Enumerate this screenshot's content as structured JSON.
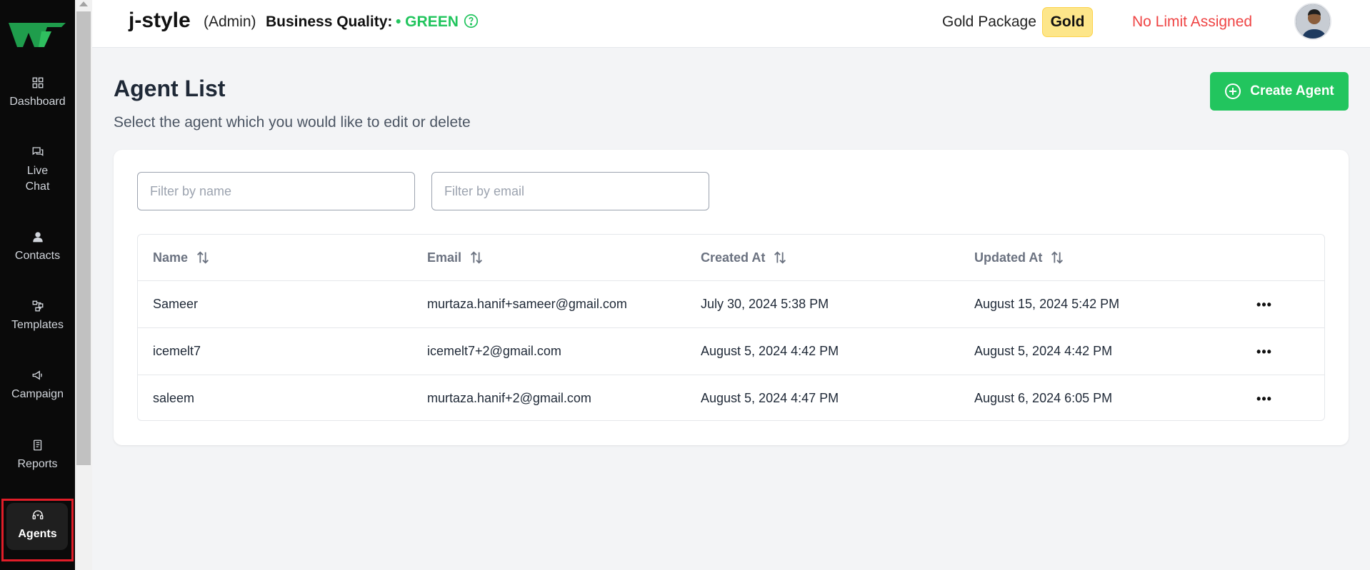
{
  "sidebar": {
    "items": [
      {
        "label": "Dashboard",
        "icon": "grid-icon"
      },
      {
        "label": "Live\nChat",
        "icon": "chat-icon"
      },
      {
        "label": "Contacts",
        "icon": "user-icon"
      },
      {
        "label": "Templates",
        "icon": "template-icon"
      },
      {
        "label": "Campaign",
        "icon": "megaphone-icon"
      },
      {
        "label": "Reports",
        "icon": "report-icon"
      },
      {
        "label": "Agents",
        "icon": "headset-icon"
      }
    ],
    "active": "Agents"
  },
  "header": {
    "brand": "j-style",
    "role": "(Admin)",
    "business_quality_label": "Business Quality:",
    "business_quality_value": "• GREEN",
    "package_label": "Gold Package",
    "package_badge": "Gold",
    "limit_text": "No Limit Assigned"
  },
  "page": {
    "title": "Agent List",
    "subtitle": "Select the agent which you would like to edit or delete",
    "create_button": "Create Agent"
  },
  "filters": {
    "name_placeholder": "Filter by name",
    "email_placeholder": "Filter by email"
  },
  "table": {
    "columns": [
      "Name",
      "Email",
      "Created At",
      "Updated At"
    ],
    "rows": [
      {
        "name": "Sameer",
        "email": "murtaza.hanif+sameer@gmail.com",
        "created": "July 30, 2024 5:38 PM",
        "updated": "August 15, 2024 5:42 PM"
      },
      {
        "name": "icemelt7",
        "email": "icemelt7+2@gmail.com",
        "created": "August 5, 2024 4:42 PM",
        "updated": "August 5, 2024 4:42 PM"
      },
      {
        "name": "saleem",
        "email": "murtaza.hanif+2@gmail.com",
        "created": "August 5, 2024 4:47 PM",
        "updated": "August 6, 2024 6:05 PM"
      }
    ],
    "row_action": "•••"
  },
  "colors": {
    "accent": "#22c55e",
    "sidebar_bg": "#0a0a0a",
    "danger": "#ef4444",
    "badge": "#fde68a"
  }
}
